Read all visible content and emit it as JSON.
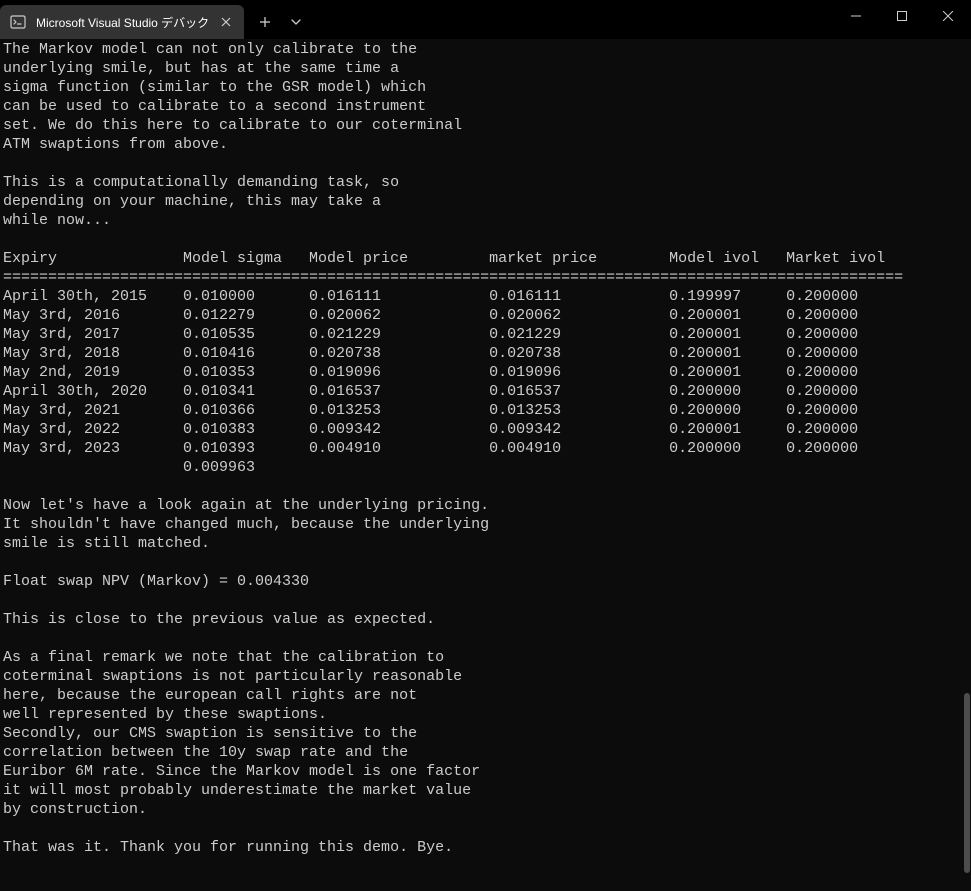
{
  "window": {
    "tab_title": "Microsoft Visual Studio デバック"
  },
  "console": {
    "para1": "The Markov model can not only calibrate to the\nunderlying smile, but has at the same time a\nsigma function (similar to the GSR model) which\ncan be used to calibrate to a second instrument\nset. We do this here to calibrate to our coterminal\nATM swaptions from above.",
    "para2": "This is a computationally demanding task, so\ndepending on your machine, this may take a\nwhile now...",
    "table_header": "Expiry              Model sigma   Model price         market price        Model ivol   Market ivol",
    "table_sep": "====================================================================================================",
    "rows": [
      "April 30th, 2015    0.010000      0.016111            0.016111            0.199997     0.200000",
      "May 3rd, 2016       0.012279      0.020062            0.020062            0.200001     0.200000",
      "May 3rd, 2017       0.010535      0.021229            0.021229            0.200001     0.200000",
      "May 3rd, 2018       0.010416      0.020738            0.020738            0.200001     0.200000",
      "May 2nd, 2019       0.010353      0.019096            0.019096            0.200001     0.200000",
      "April 30th, 2020    0.010341      0.016537            0.016537            0.200000     0.200000",
      "May 3rd, 2021       0.010366      0.013253            0.013253            0.200000     0.200000",
      "May 3rd, 2022       0.010383      0.009342            0.009342            0.200001     0.200000",
      "May 3rd, 2023       0.010393      0.004910            0.004910            0.200000     0.200000",
      "                    0.009963"
    ],
    "para3": "Now let's have a look again at the underlying pricing.\nIt shouldn't have changed much, because the underlying\nsmile is still matched.",
    "npv_line": "Float swap NPV (Markov) = 0.004330",
    "para4": "This is close to the previous value as expected.",
    "para5": "As a final remark we note that the calibration to\ncoterminal swaptions is not particularly reasonable\nhere, because the european call rights are not\nwell represented by these swaptions.\nSecondly, our CMS swaption is sensitive to the\ncorrelation between the 10y swap rate and the\nEuribor 6M rate. Since the Markov model is one factor\nit will most probably underestimate the market value\nby construction.",
    "para6": "That was it. Thank you for running this demo. Bye."
  }
}
